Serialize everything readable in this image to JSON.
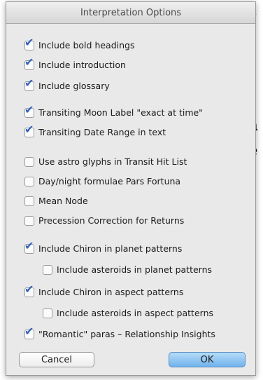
{
  "background": {
    "fragments": [
      "s",
      ".",
      "a",
      "e",
      ".",
      "f",
      ".",
      "t"
    ]
  },
  "dialog": {
    "title": "Interpretation Options",
    "options": [
      {
        "label": "Include bold headings",
        "checked": true
      },
      {
        "label": "Include introduction",
        "checked": true
      },
      {
        "label": "Include glossary",
        "checked": true
      },
      {
        "label": "Transiting Moon Label \"exact at time\"",
        "checked": true
      },
      {
        "label": "Transiting Date Range in text",
        "checked": true
      },
      {
        "label": "Use astro glyphs in Transit Hit List",
        "checked": false
      },
      {
        "label": "Day/night formulae Pars Fortuna",
        "checked": false
      },
      {
        "label": "Mean Node",
        "checked": false
      },
      {
        "label": "Precession Correction for Returns",
        "checked": false
      },
      {
        "label": "Include Chiron in planet patterns",
        "checked": true
      },
      {
        "label": "Include asteroids in planet patterns",
        "checked": false
      },
      {
        "label": "Include Chiron in aspect patterns",
        "checked": true
      },
      {
        "label": "Include asteroids in aspect patterns",
        "checked": false
      },
      {
        "label": "\"Romantic\" paras – Relationship Insights",
        "checked": true
      }
    ],
    "buttons": {
      "cancel": "Cancel",
      "ok": "OK"
    },
    "accent_color": "#2f62c8"
  }
}
